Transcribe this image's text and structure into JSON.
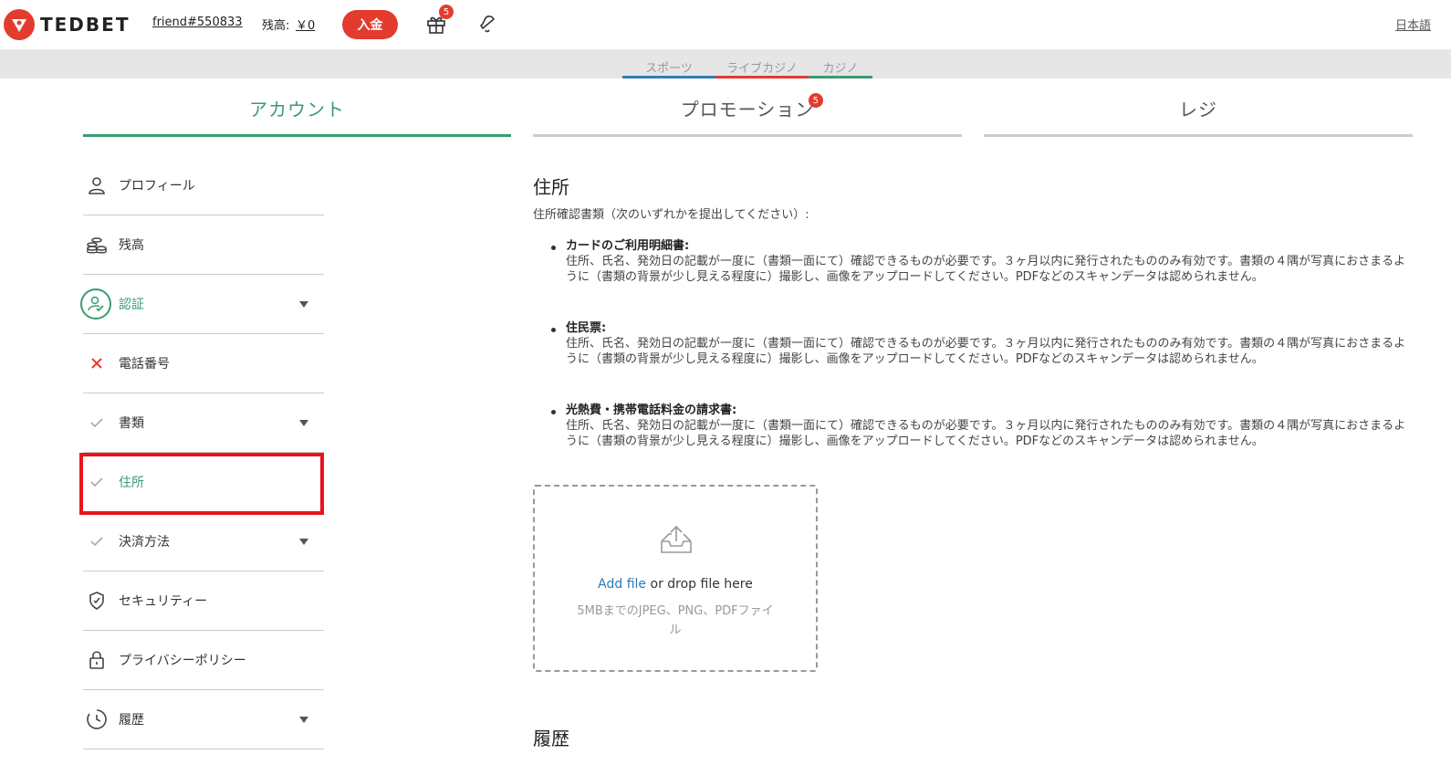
{
  "header": {
    "brand": "TEDBET",
    "username": "friend#550833",
    "balance_label": "残高:",
    "balance_value": "￥0",
    "deposit_label": "入金",
    "gift_count": "5",
    "language": "日本語"
  },
  "product_tabs": [
    {
      "label": "スポーツ",
      "color": "#2f7fb8"
    },
    {
      "label": "ライブカジノ",
      "color": "#e33b2e"
    },
    {
      "label": "カジノ",
      "color": "#3a9b71"
    }
  ],
  "main_tabs": [
    {
      "label": "アカウント",
      "active": true
    },
    {
      "label": "プロモーション",
      "badge": "5"
    },
    {
      "label": "レジ"
    }
  ],
  "sidebar": {
    "items": [
      {
        "label": "プロフィール",
        "icon": "user-icon"
      },
      {
        "label": "残高",
        "icon": "coins-icon"
      },
      {
        "label": "認証",
        "icon": "verified-user-icon"
      },
      {
        "label": "電話番号",
        "icon": "cross-icon"
      },
      {
        "label": "書類",
        "icon": "check-icon"
      },
      {
        "label": "住所",
        "icon": "check-icon"
      },
      {
        "label": "決済方法",
        "icon": "check-icon"
      },
      {
        "label": "セキュリティー",
        "icon": "shield-icon"
      },
      {
        "label": "プライバシーポリシー",
        "icon": "lock-icon"
      },
      {
        "label": "履歴",
        "icon": "clock-icon"
      }
    ]
  },
  "content": {
    "title": "住所",
    "subtitle": "住所確認書類（次のいずれかを提出してください）:",
    "documents": [
      {
        "title": "カードのご利用明細書:",
        "desc": "住所、氏名、発効日の記載が一度に（書類一面にて）確認できるものが必要です。３ヶ月以内に発行されたもののみ有効です。書類の４隅が写真におさまるように（書類の背景が少し見える程度に）撮影し、画像をアップロードしてください。PDFなどのスキャンデータは認められません。"
      },
      {
        "title": "住民票:",
        "desc": "住所、氏名、発効日の記載が一度に（書類一面にて）確認できるものが必要です。３ヶ月以内に発行されたもののみ有効です。書類の４隅が写真におさまるように（書類の背景が少し見える程度に）撮影し、画像をアップロードしてください。PDFなどのスキャンデータは認められません。"
      },
      {
        "title": "光熱費・携帯電話料金の請求書:",
        "desc": "住所、氏名、発効日の記載が一度に（書類一面にて）確認できるものが必要です。３ヶ月以内に発行されたもののみ有効です。書類の４隅が写真におさまるように（書類の背景が少し見える程度に）撮影し、画像をアップロードしてください。PDFなどのスキャンデータは認められません。"
      }
    ],
    "dropzone": {
      "link": "Add file",
      "text": " or drop file here",
      "hint": "5MBまでのJPEG、PNG、PDFファイル"
    },
    "history_title": "履歴"
  }
}
